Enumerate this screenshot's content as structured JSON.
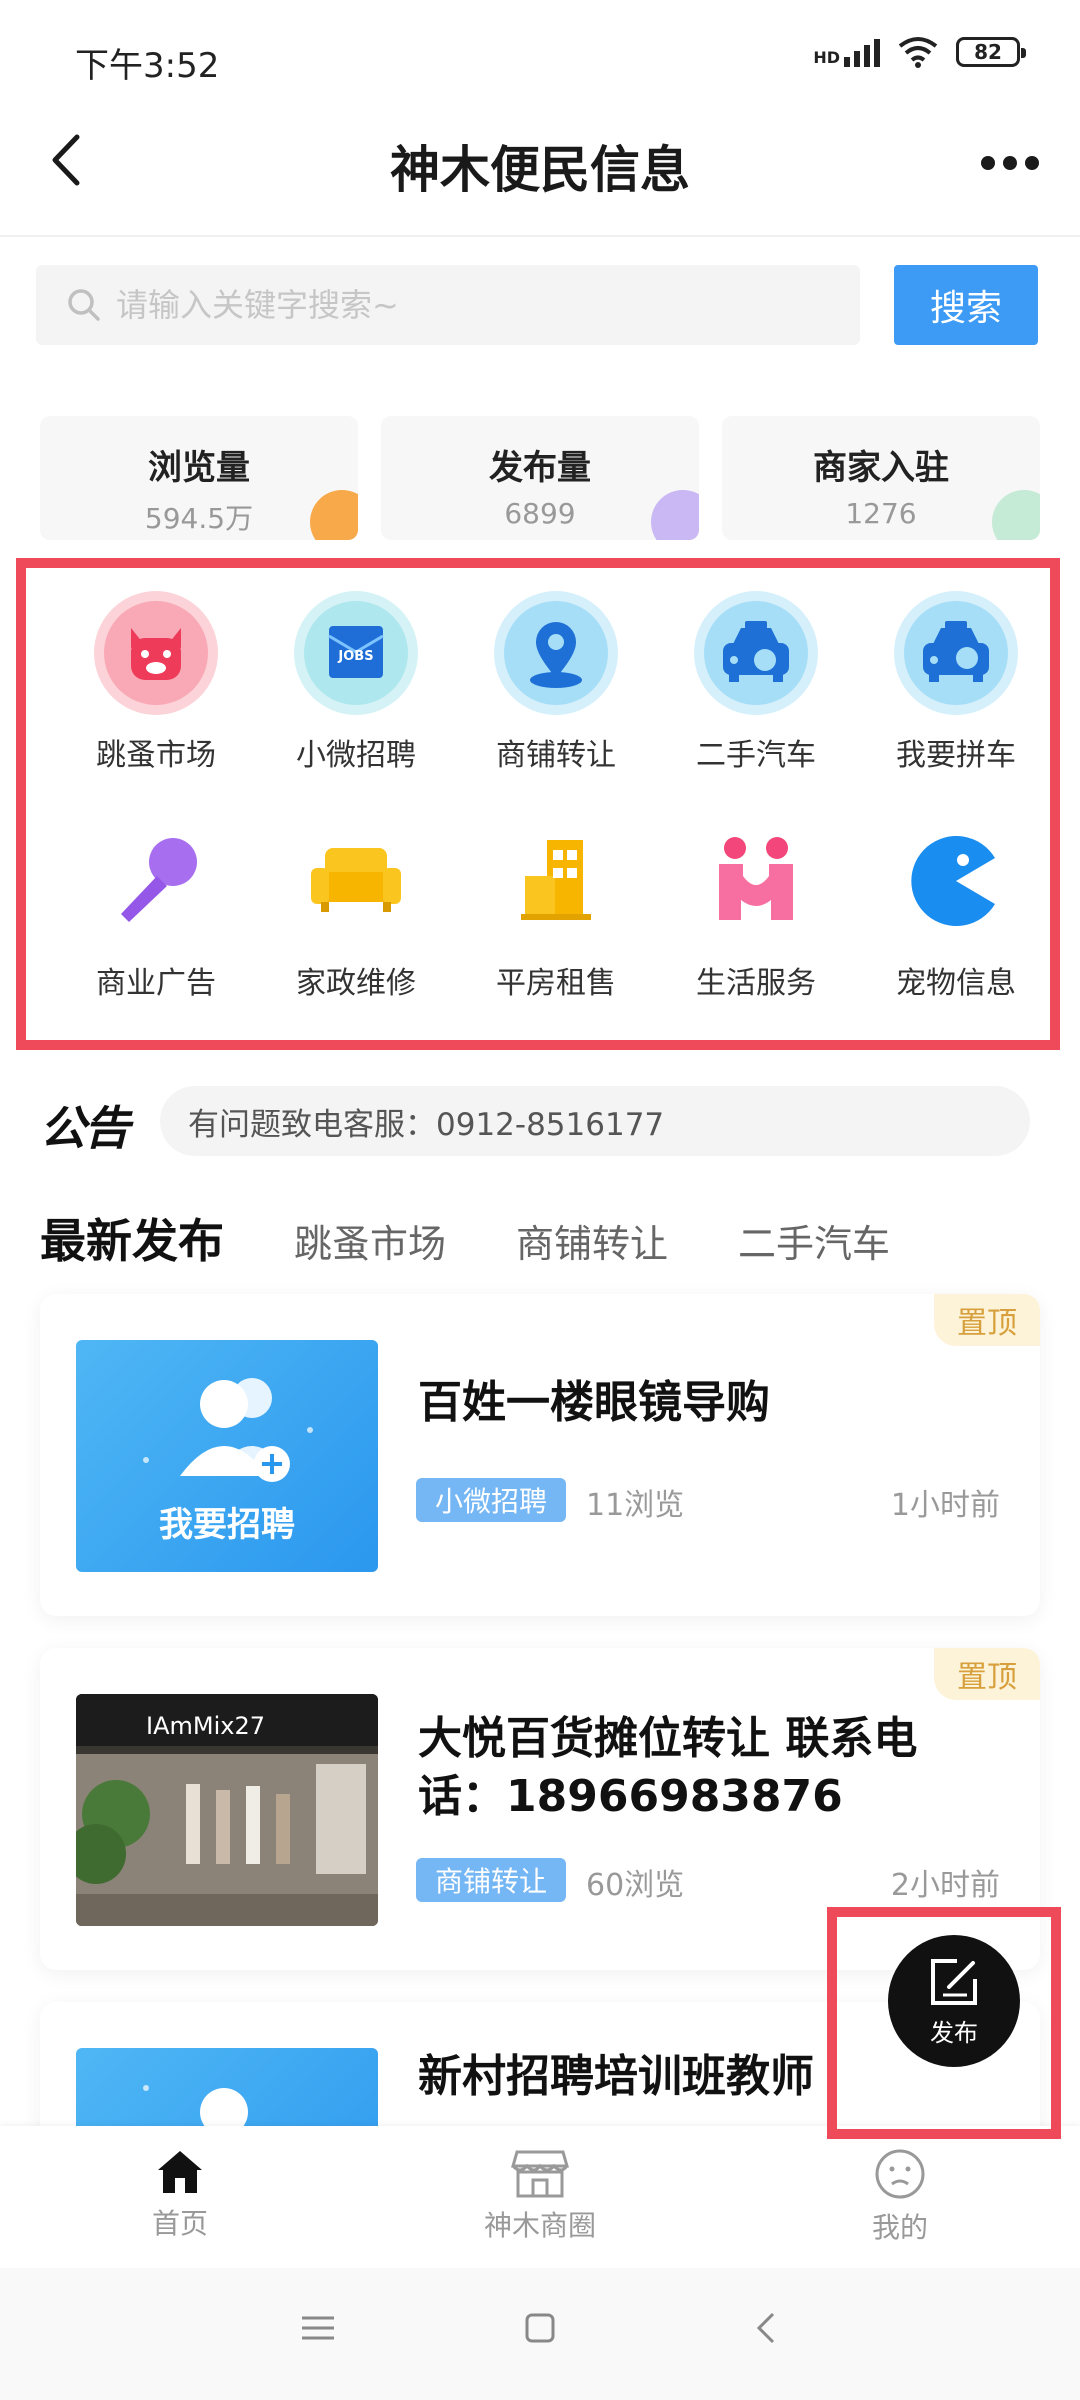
{
  "status_bar": {
    "time": "下午3:52",
    "network": "HD",
    "battery": "82"
  },
  "header": {
    "title": "神木便民信息"
  },
  "search": {
    "placeholder": "请输入关键字搜索~",
    "button_label": "搜索"
  },
  "stats": [
    {
      "label": "浏览量",
      "value": "594.5万",
      "color": "#f8a94a"
    },
    {
      "label": "发布量",
      "value": "6899",
      "color": "#c9b8f3"
    },
    {
      "label": "商家入驻",
      "value": "1276",
      "color": "#c5ead6"
    }
  ],
  "categories": [
    {
      "label": "跳蚤市场",
      "icon": "pig-icon"
    },
    {
      "label": "小微招聘",
      "icon": "jobs-icon"
    },
    {
      "label": "商铺转让",
      "icon": "location-pin-icon"
    },
    {
      "label": "二手汽车",
      "icon": "used-car-icon"
    },
    {
      "label": "我要拼车",
      "icon": "carpool-icon"
    },
    {
      "label": "商业广告",
      "icon": "microphone-icon"
    },
    {
      "label": "家政维修",
      "icon": "sofa-icon"
    },
    {
      "label": "平房租售",
      "icon": "building-icon"
    },
    {
      "label": "生活服务",
      "icon": "people-icon"
    },
    {
      "label": "宠物信息",
      "icon": "pacman-icon"
    }
  ],
  "notice": {
    "logo": "公告",
    "text": "有问题致电客服：0912-8516177"
  },
  "feed_tabs": {
    "active": "最新发布",
    "others": [
      "跳蚤市场",
      "商铺转让",
      "二手汽车"
    ]
  },
  "posts": [
    {
      "title": "百姓一楼眼镜导购",
      "pin": "置顶",
      "tag": "小微招聘",
      "views": "11浏览",
      "time": "1小时前",
      "thumb_text": "我要招聘"
    },
    {
      "title": "大悦百货摊位转让 联系电话：18966983876",
      "pin": "置顶",
      "tag": "商铺转让",
      "views": "60浏览",
      "time": "2小时前",
      "thumb_text": "IAmMix27"
    },
    {
      "title": "新村招聘培训班教师"
    }
  ],
  "fab": {
    "label": "发布"
  },
  "bottom_nav": [
    {
      "label": "首页",
      "icon": "home-icon",
      "active": true
    },
    {
      "label": "神木商圈",
      "icon": "shop-icon",
      "active": false
    },
    {
      "label": "我的",
      "icon": "face-icon",
      "active": false
    }
  ],
  "colors": {
    "accent": "#3d9bf5",
    "highlight": "#ef4a5a",
    "pin": "#d7a03c",
    "tag": "#75b6f4"
  }
}
